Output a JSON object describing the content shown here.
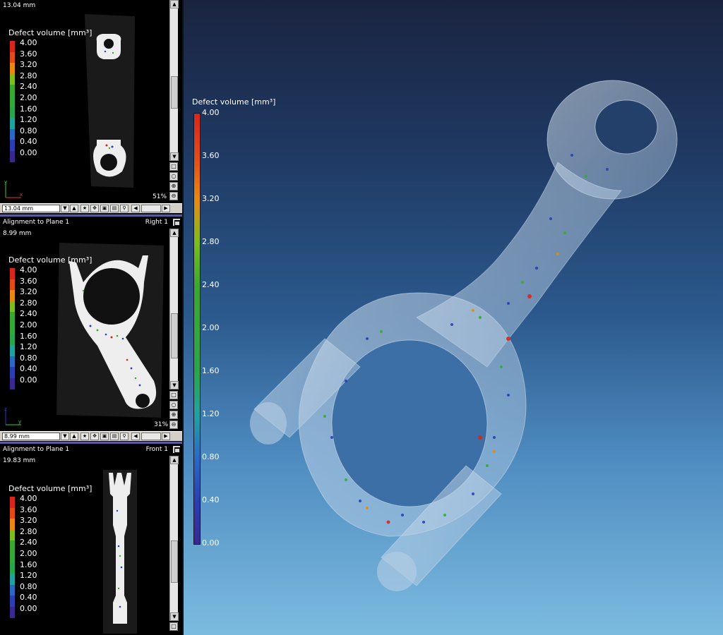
{
  "legend": {
    "title": "Defect volume [mm³]",
    "labels": [
      "4.00",
      "3.60",
      "3.20",
      "2.80",
      "2.40",
      "2.00",
      "1.60",
      "1.20",
      "0.80",
      "0.40",
      "0.00"
    ],
    "colors": [
      "#d8261c",
      "#e24a18",
      "#e88a10",
      "#7ebd1a",
      "#3aa830",
      "#35a83a",
      "#2aa64a",
      "#20a3a0",
      "#2a6ac4",
      "#2a3fb0",
      "#3a2890"
    ]
  },
  "main_legend": {
    "title": "Defect volume [mm³]",
    "labels": [
      "4.00",
      "3.60",
      "3.20",
      "2.80",
      "2.40",
      "2.00",
      "1.60",
      "1.20",
      "0.80",
      "0.40",
      "0.00"
    ]
  },
  "panes": [
    {
      "header": "",
      "view": "",
      "distance": "13.04 mm",
      "zoom": "51%",
      "combo_value": "13.04 mm"
    },
    {
      "header": "Alignment to Plane 1",
      "view": "Right 1",
      "distance": "8.99 mm",
      "zoom": "31%",
      "combo_value": "8.99 mm"
    },
    {
      "header": "Alignment to Plane 1",
      "view": "Front 1",
      "distance": "19.83 mm",
      "zoom": "",
      "combo_value": ""
    }
  ],
  "icons": {
    "scroll_up": "scroll-up-arrow-icon",
    "scroll_down": "scroll-down-arrow-icon",
    "zoom_in": "zoom-in-icon",
    "zoom_out": "zoom-out-icon",
    "fit": "fit-view-icon",
    "pan": "pan-icon",
    "maximize": "maximize-icon"
  }
}
